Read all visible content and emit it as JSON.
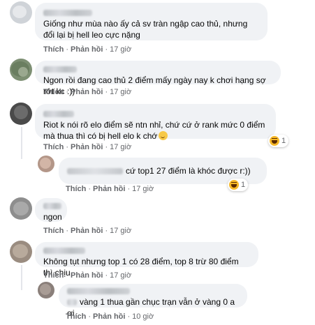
{
  "labels": {
    "like": "Thích",
    "reply": "Phản hồi",
    "dot": "·"
  },
  "comments": [
    {
      "author": "",
      "text": "Giống như mùa nào ấy cả sv tràn ngập cao thủ, nhưng đổi lại bị hell leo cực nặng",
      "time": "17 giờ"
    },
    {
      "author": "",
      "text": "Ngon rồi đang cao thủ 2 điểm mấy ngày nay k chơi hạng sợ rớt kc :))",
      "time": "17 giờ"
    },
    {
      "author": "",
      "text": "Riot k nói rõ elo điểm sẽ ntn nhỉ, chứ cứ ở rank mức 0 điểm mà thua thì có bị hell elo k chớ",
      "time": "17 giờ",
      "reaction": {
        "icon": "haha-reaction-icon",
        "count": "1"
      },
      "reply": {
        "author": "",
        "text": "cứ top1 27 điểm là khóc được r:))",
        "time": "17 giờ",
        "reaction": {
          "icon": "haha-reaction-icon",
          "count": "1"
        }
      }
    },
    {
      "author": "",
      "text": "ngon",
      "time": "17 giờ"
    },
    {
      "author": "",
      "text": "Không tụt nhưng top 1 có 28 điểm, top 8 trừ 80 điểm thì chịu.",
      "time": "17 giờ",
      "reply": {
        "author": "",
        "text": "vàng 1 thua gần chục trạn vẫn ở vàng 0 a ơi",
        "time": "10 giờ"
      }
    }
  ],
  "colors": {
    "bubble": "#f0f2f5",
    "secondary_text": "#65676b",
    "haha_yellow": "#f7b928"
  }
}
